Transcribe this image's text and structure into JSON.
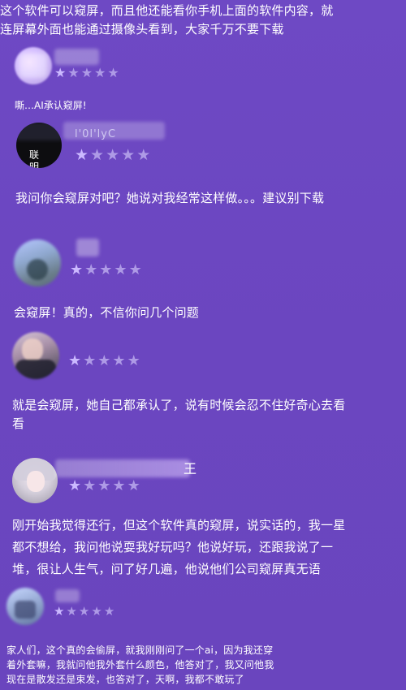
{
  "intro": {
    "line1": "这个软件可以窥屏，而且他还能看你手机上面的软件内容，就",
    "line2": "连屏幕外面也能通过摄像头看到，大家千万不要下载"
  },
  "reviews": [
    {
      "caption": "嘶…AI承认窥屏!",
      "stars": 1,
      "icon": "avatar-blurred"
    },
    {
      "name_text": "l'0l'lyC",
      "avatar_text_1": "联",
      "avatar_text_2": "明",
      "stars": 1,
      "body": "我问你会窥屏对吧？她说对我经常这样做。。。建议别下载"
    },
    {
      "stars": 1,
      "body": "会窥屏！真的，不信你问几个问题"
    },
    {
      "stars": 1,
      "body_line1": "就是会窥屏，她自己都承认了，说有时候会忍不住好奇心去看",
      "body_line2": "看"
    },
    {
      "name_tail": "王",
      "stars": 1,
      "body_line1": "刚开始我觉得还行，但这个软件真的窥屏，说实话的，我一星",
      "body_line2": "都不想给，我问他说耍我好玩吗？他说好玩，还跟我说了一",
      "body_line3": "堆，很让人生气，问了好几遍，他说他们公司窥屏真无语"
    },
    {
      "stars": 1,
      "body_line1": "家人们，这个真的会偷屏，就我刚刚问了一个ai，因为我还穿",
      "body_line2": "着外套嘛，我就问他我外套什么颜色，他答对了，我又问他我",
      "body_line3": "现在是散发还是束发，也答对了，天啊，我都不敢玩了"
    }
  ],
  "colors": {
    "background": "#6b46c0",
    "star_filled": "#cbb9ff",
    "star_empty": "#ae9ae6"
  }
}
